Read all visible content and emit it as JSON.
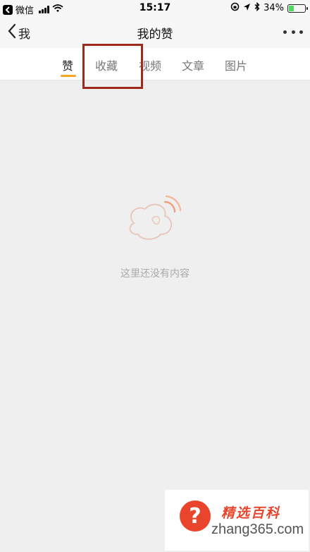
{
  "status_bar": {
    "carrier": "微信",
    "time": "15:17",
    "battery_percent": "34%",
    "battery_level": 0.34
  },
  "nav": {
    "back_label": "我",
    "title": "我的赞"
  },
  "tabs": [
    {
      "label": "赞",
      "active": true
    },
    {
      "label": "收藏",
      "active": false
    },
    {
      "label": "视频",
      "active": false
    },
    {
      "label": "文章",
      "active": false
    },
    {
      "label": "图片",
      "active": false
    }
  ],
  "empty_state": {
    "message": "这里还没有内容"
  },
  "watermark": {
    "title": "精选百科",
    "domain": "zhang365.com"
  },
  "colors": {
    "accent": "#f5a623",
    "highlight_border": "#9e2a1c",
    "watermark_red": "#e8452c",
    "battery_green": "#4cd964"
  }
}
